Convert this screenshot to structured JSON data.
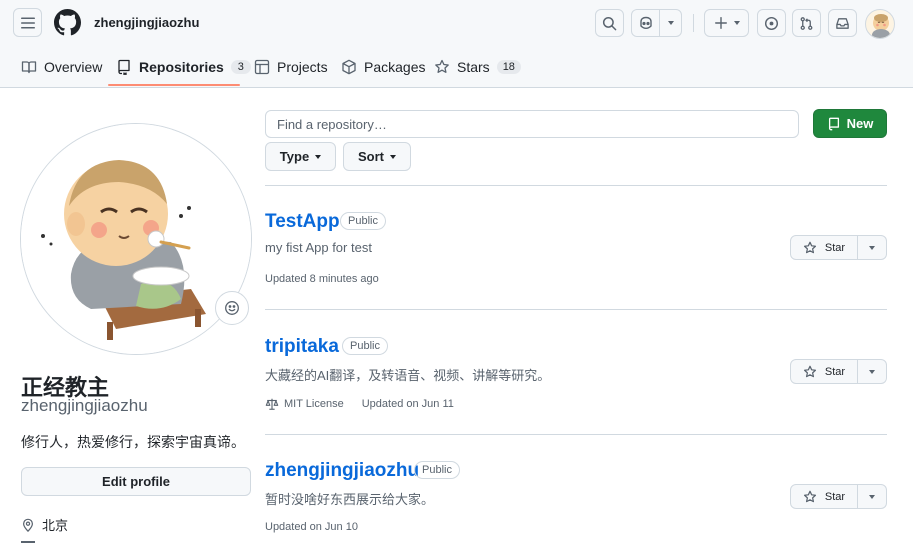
{
  "header": {
    "username": "zhengjingjiaozhu",
    "icons": [
      "menu-icon",
      "github-logo",
      "search-icon",
      "copilot-icon",
      "plus-icon",
      "issues-icon",
      "pull-requests-icon",
      "inbox-icon"
    ]
  },
  "tabs": [
    {
      "label": "Overview",
      "icon": "book-icon"
    },
    {
      "label": "Repositories",
      "icon": "repo-icon",
      "count": "3",
      "active": true
    },
    {
      "label": "Projects",
      "icon": "table-icon"
    },
    {
      "label": "Packages",
      "icon": "package-icon"
    },
    {
      "label": "Stars",
      "icon": "star-icon",
      "count": "18"
    }
  ],
  "profile": {
    "display_name": "正经教主",
    "login": "zhengjingjiaozhu",
    "bio": "修行人，热爱修行，探索宇宙真谛。",
    "edit_label": "Edit profile",
    "location": "北京"
  },
  "search": {
    "placeholder": "Find a repository…"
  },
  "new_label": "New",
  "filters": {
    "type_label": "Type",
    "sort_label": "Sort"
  },
  "repos": [
    {
      "name": "TestApp",
      "visibility": "Public",
      "description": "my fist App for test",
      "updated": "Updated 8 minutes ago"
    },
    {
      "name": "tripitaka",
      "visibility": "Public",
      "description": "大藏经的AI翻译，及转语音、视频、讲解等研究。",
      "license": "MIT License",
      "updated": "Updated on Jun 11"
    },
    {
      "name": "zhengjingjiaozhu",
      "visibility": "Public",
      "description": "暂时没啥好东西展示给大家。",
      "updated": "Updated on Jun 10"
    }
  ],
  "star_label": "Star",
  "colors": {
    "accent": "#0969da",
    "new_button": "#1f883d",
    "tab_underline": "#fd8c73"
  }
}
